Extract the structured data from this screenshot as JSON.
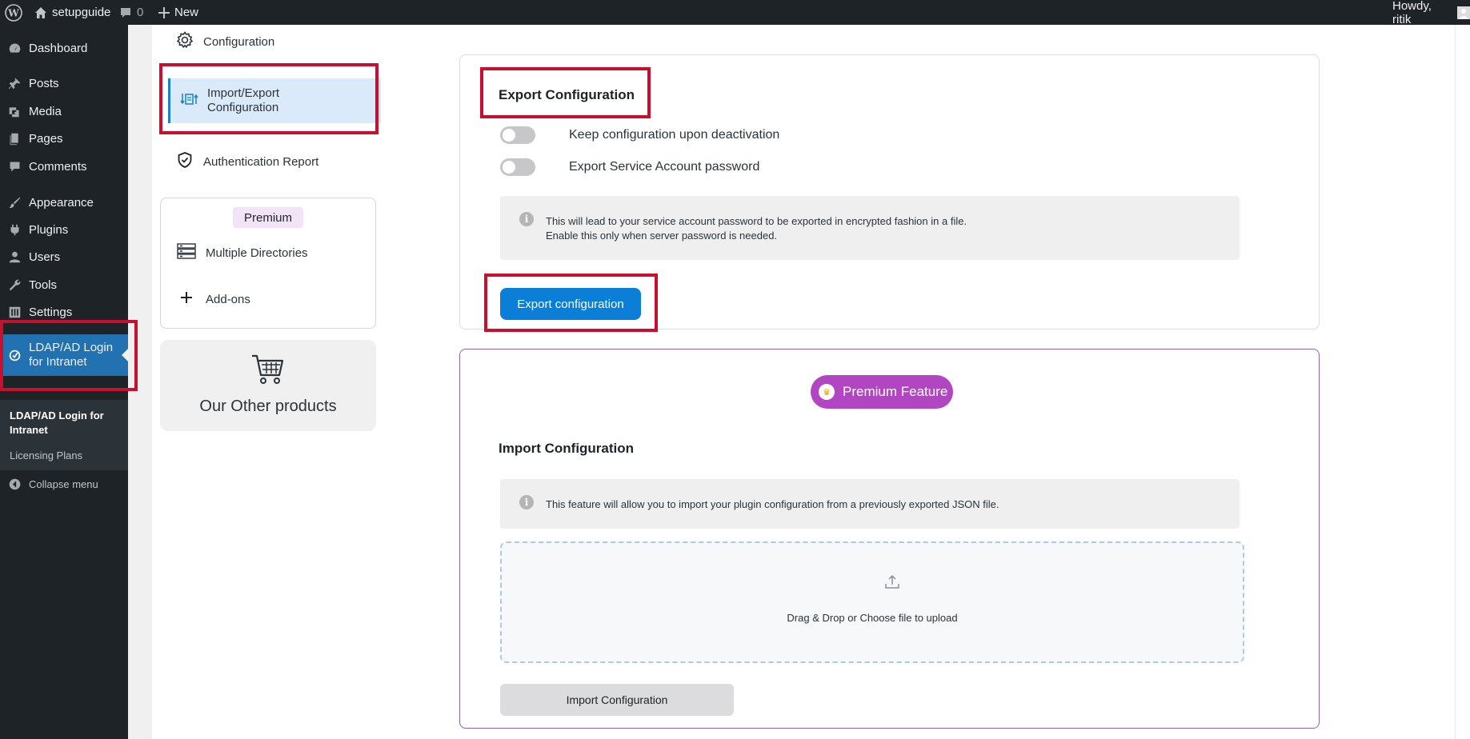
{
  "adminbar": {
    "site_name": "setupguide",
    "comments_count": "0",
    "new_label": "New",
    "howdy": "Howdy, ritik"
  },
  "menu": {
    "dashboard": "Dashboard",
    "posts": "Posts",
    "media": "Media",
    "pages": "Pages",
    "comments": "Comments",
    "appearance": "Appearance",
    "plugins": "Plugins",
    "users": "Users",
    "tools": "Tools",
    "settings": "Settings",
    "ldap": "LDAP/AD Login for Intranet",
    "submenu_title": "LDAP/AD Login for Intranet",
    "licensing": "Licensing Plans",
    "collapse": "Collapse menu"
  },
  "plugin_nav": {
    "configuration": "Configuration",
    "import_export": "Import/Export Configuration",
    "auth_report": "Authentication Report",
    "premium_tag": "Premium",
    "multiple_directories": "Multiple Directories",
    "addons": "Add-ons",
    "other_products": "Our Other products"
  },
  "export": {
    "title": "Export Configuration",
    "toggle_keep": "Keep configuration upon deactivation",
    "toggle_password": "Export Service Account password",
    "info_line1": "This will lead to your service account password to be exported in encrypted fashion in a file.",
    "info_line2": "Enable this only when server password is needed.",
    "button": "Export configuration"
  },
  "import": {
    "premium_badge": "Premium Feature",
    "title": "Import Configuration",
    "info": "This feature will allow you to import your plugin configuration from a previously exported JSON file.",
    "dropzone_text": "Drag & Drop or Choose file to upload",
    "button": "Import Configuration"
  },
  "colors": {
    "admin_dark": "#1d2327",
    "wp_blue": "#2271b1",
    "primary_button": "#0b7ed8",
    "premium_purple": "#b145c2",
    "highlight_red": "#c8102e"
  }
}
